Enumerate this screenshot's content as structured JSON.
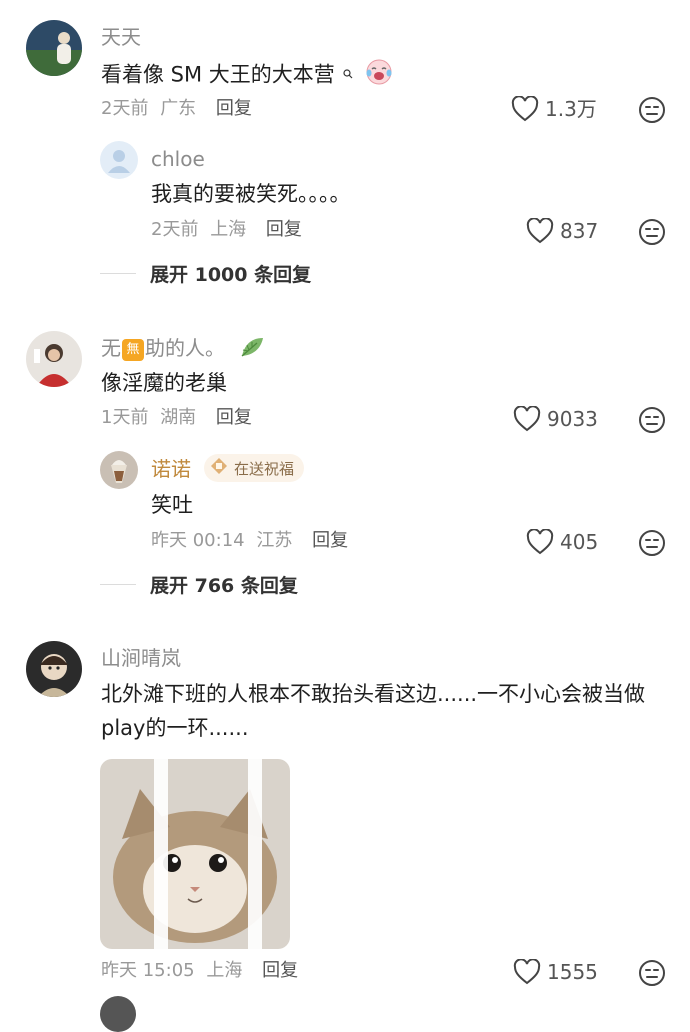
{
  "comments": [
    {
      "name": "天天",
      "text": "看着像 SM 大王的大本营",
      "time": "2天前",
      "location": "广东",
      "reply_label": "回复",
      "likes": "1.3万",
      "replies": [
        {
          "name": "chloe",
          "text": "我真的要被笑死。。。。",
          "time": "2天前",
          "location": "上海",
          "reply_label": "回复",
          "likes": "837"
        }
      ],
      "expand_label": "展开 1000 条回复"
    },
    {
      "name_prefix": "无",
      "name_badge": "無",
      "name_suffix": "助的人。",
      "text": "像淫魔的老巢",
      "time": "1天前",
      "location": "湖南",
      "reply_label": "回复",
      "likes": "9033",
      "replies": [
        {
          "name": "诺诺",
          "tag": "在送祝福",
          "text": "笑吐",
          "time": "昨天 00:14",
          "location": "江苏",
          "reply_label": "回复",
          "likes": "405"
        }
      ],
      "expand_label": "展开 766 条回复"
    },
    {
      "name": "山涧晴岚",
      "text_line1": "北外滩下班的人根本不敢抬头看这边......一不小心会被当做",
      "text_line2": "play的一环......",
      "time": "昨天 15:05",
      "location": "上海",
      "reply_label": "回复",
      "likes": "1555"
    }
  ],
  "icons": {
    "like": "heart-outline-icon",
    "dislike": "neutral-face-icon",
    "search_hint": "search-icon",
    "laughing_emoji": "laughing-crying-emoji",
    "leaf": "leaf-icon",
    "gift_tag": "gift-icon"
  },
  "colors": {
    "name": "#8c8c8c",
    "meta": "#999999",
    "badge": "#f5a623",
    "tag_bg": "#fbf3e9",
    "leaf": "#6aa84f"
  }
}
